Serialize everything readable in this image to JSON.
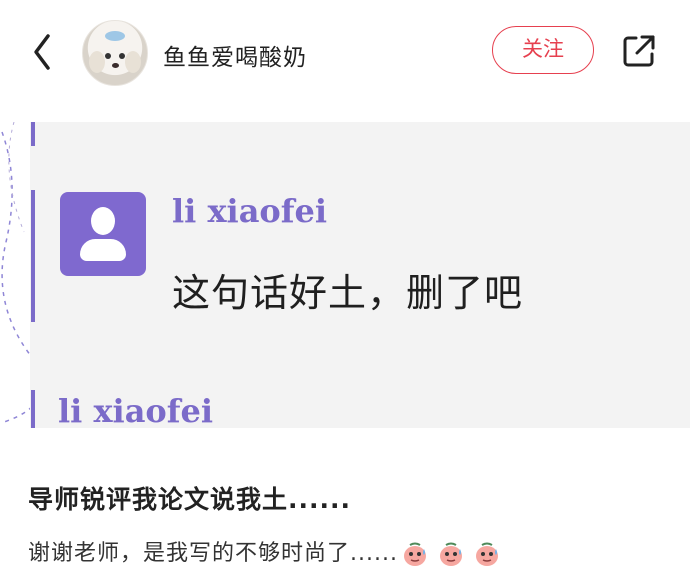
{
  "header": {
    "username": "鱼鱼爱喝酸奶",
    "follow_label": "关注"
  },
  "screenshot": {
    "quote_name": "li xiaofei",
    "quote_text": "这句话好土，删了吧",
    "next_name": "li xiaofei",
    "accent_color": "#7b6bc9"
  },
  "post": {
    "title": "导师锐评我论文说我土......",
    "body": "谢谢老师，是我写的不够时尚了......",
    "emojis": [
      "sweat-smile-emoji",
      "sweat-smile-emoji",
      "sweat-smile-emoji"
    ]
  },
  "colors": {
    "follow": "#e6404f"
  }
}
